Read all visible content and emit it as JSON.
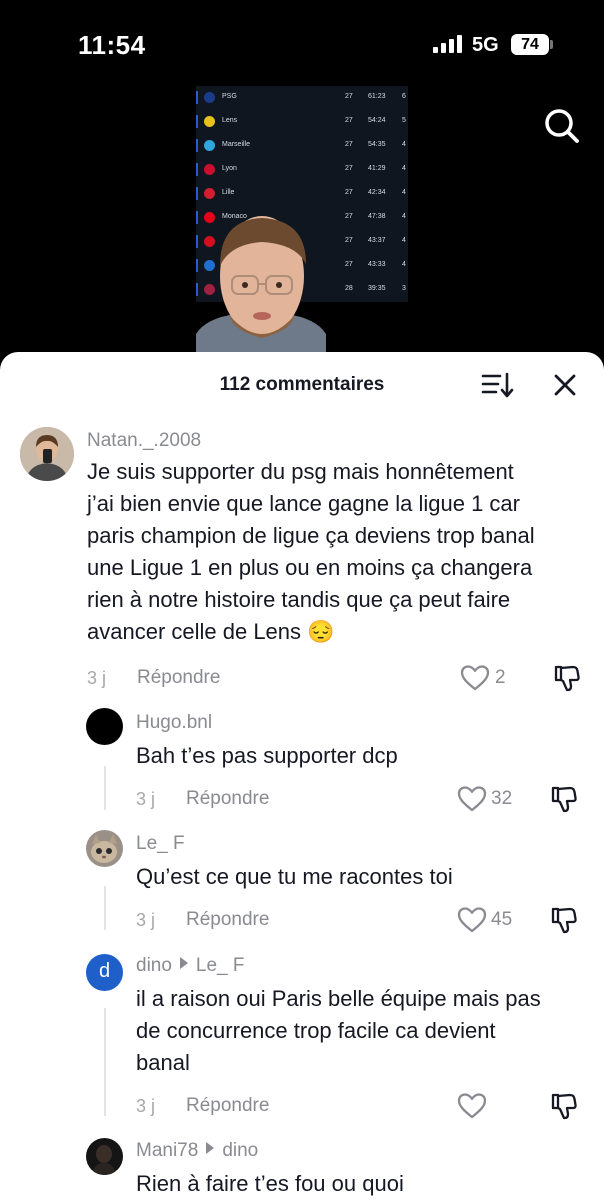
{
  "status_bar": {
    "time": "11:54",
    "network": "5G",
    "battery": "74"
  },
  "video": {
    "standings": [
      {
        "team": "PSG",
        "played": "27",
        "goals": "61:23",
        "points": "6",
        "badge_color": "#1a3a8a"
      },
      {
        "team": "Lens",
        "played": "27",
        "goals": "54:24",
        "points": "5",
        "badge_color": "#e8c020"
      },
      {
        "team": "Marseille",
        "played": "27",
        "goals": "54:35",
        "points": "4",
        "badge_color": "#2fa6de"
      },
      {
        "team": "Lyon",
        "played": "27",
        "goals": "41:29",
        "points": "4",
        "badge_color": "#c8102e"
      },
      {
        "team": "Lille",
        "played": "27",
        "goals": "42:34",
        "points": "4",
        "badge_color": "#d01f2f"
      },
      {
        "team": "Monaco",
        "played": "27",
        "goals": "47:38",
        "points": "4",
        "badge_color": "#e2001a"
      },
      {
        "team": "",
        "played": "27",
        "goals": "43:37",
        "points": "4",
        "badge_color": "#d10f1f"
      },
      {
        "team": "",
        "played": "27",
        "goals": "43:33",
        "points": "4",
        "badge_color": "#1f6fd1"
      },
      {
        "team": "",
        "played": "28",
        "goals": "39:35",
        "points": "3",
        "badge_color": "#a02040"
      }
    ]
  },
  "sheet": {
    "title": "112 commentaires",
    "comments": [
      {
        "username": "Natan._.2008",
        "reply_to": "",
        "text_lines": [
          "Je suis supporter du psg mais honnêtement",
          "j’ai bien envie que lance gagne la ligue 1 car",
          "paris champion de ligue ça deviens trop banal",
          "une Ligue 1 en plus ou en moins ça changera",
          "rien à notre histoire tandis que ça peut faire",
          "avancer celle de Lens 😔"
        ],
        "time": "3 j",
        "reply_label": "Répondre",
        "likes": "2"
      },
      {
        "username": "Hugo.bnl",
        "reply_to": "",
        "text_lines": [
          "Bah t’es pas supporter dcp"
        ],
        "time": "3 j",
        "reply_label": "Répondre",
        "likes": "32"
      },
      {
        "username": "Le_ F",
        "reply_to": "",
        "text_lines": [
          "Qu’est ce que tu me racontes toi"
        ],
        "time": "3 j",
        "reply_label": "Répondre",
        "likes": "45"
      },
      {
        "username": "dino",
        "reply_to": "Le_ F",
        "avatar_letter": "d",
        "text_lines": [
          "il a raison oui Paris belle équipe mais pas",
          "de concurrence trop facile ca devient",
          "banal"
        ],
        "time": "3 j",
        "reply_label": "Répondre",
        "likes": ""
      },
      {
        "username": "Mani78",
        "reply_to": "dino",
        "text_lines": [
          "Rien à faire t’es fou ou quoi"
        ],
        "time": "",
        "reply_label": "",
        "likes": ""
      }
    ]
  },
  "colors": {
    "accent_blue": "#1f5fc9",
    "text_dark": "#161823",
    "text_grey": "#8a8b91"
  }
}
